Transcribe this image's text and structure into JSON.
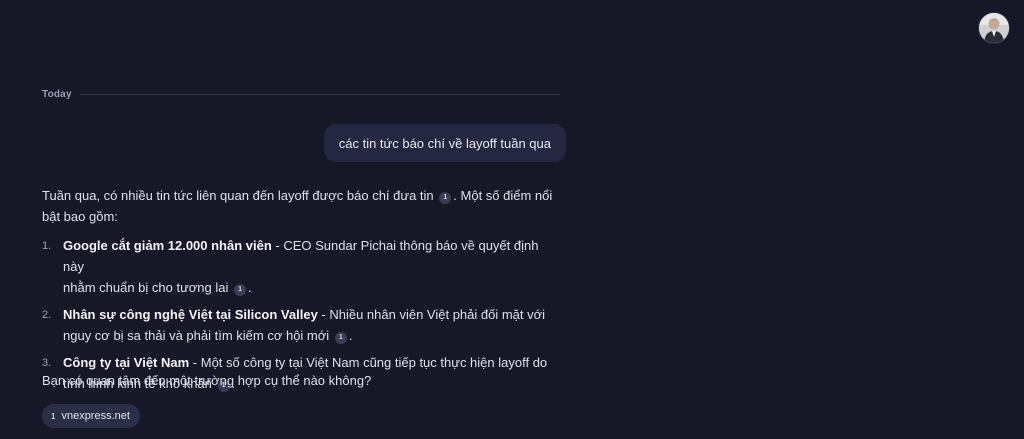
{
  "divider": {
    "label": "Today"
  },
  "user_message": {
    "text": "các tin tức báo chí về layoff tuần qua"
  },
  "assistant": {
    "intro_line1": "Tuần qua, có nhiều tin tức liên quan đến layoff được báo chí đưa tin",
    "intro_line1_after": ". Một số điểm nổi",
    "intro_line2": "bật bao gồm:",
    "items": [
      {
        "number": "1.",
        "title": "Google cắt giảm 12.000 nhân viên",
        "line1_rest": " - CEO Sundar Pichai thông báo về quyết định này",
        "line2": "nhằm chuẩn bị cho tương lai",
        "cite": "1"
      },
      {
        "number": "2.",
        "title": "Nhân sự công nghệ Việt tại Silicon Valley",
        "line1_rest": " - Nhiều nhân viên Việt phải đối mặt với",
        "line2": "nguy cơ bị sa thải và phải tìm kiếm cơ hội mới",
        "cite": "1"
      },
      {
        "number": "3.",
        "title": "Công ty tại Việt Nam",
        "line1_rest": " - Một số công ty tại Việt Nam cũng tiếp tục thực hiện layoff do",
        "line2": "tình hình kinh tế khó khăn",
        "cite": "1"
      }
    ],
    "intro_cite": "1",
    "followup": "Bạn có quan tâm đến một trường hợp cụ thể nào không?"
  },
  "sources": [
    {
      "number": "1",
      "label": "vnexpress.net"
    }
  ],
  "icons": {
    "avatar": "user-avatar"
  }
}
